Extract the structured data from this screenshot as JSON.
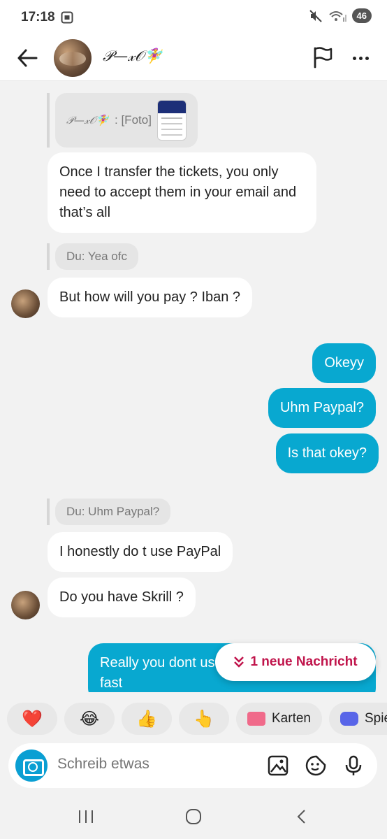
{
  "status": {
    "time": "17:18",
    "battery": "46"
  },
  "header": {
    "contact_name": "𝒫—𝓍𝒪🧚‍♀️"
  },
  "messages": {
    "quote1_name": "𝒫—𝓍𝒪🧚‍♀️",
    "quote1_text": ": [Foto]",
    "m1": "Once I transfer the tickets, you only need to accept them in your email and that’s all",
    "quote2": "Du: Yea ofc",
    "m2": "But how will you pay ? Iban ?",
    "o1": "Okeyy",
    "o2": "Uhm Paypal?",
    "o3": "Is that okey?",
    "quote3": "Du: Uhm Paypal?",
    "m3": "I honestly do t use PayPal",
    "m4": "Do you have Skrill ?",
    "o4": "Really you dont use it? It's more chilly and fast"
  },
  "new_message_pill": "1 neue Nachricht",
  "quick_replies": {
    "heart": "❤️",
    "laugh": "😂",
    "thumbs": "👍",
    "point": "👆",
    "cards": "Karten",
    "games": "Spie"
  },
  "composer": {
    "placeholder": "Schreib etwas"
  },
  "colors": {
    "accent": "#0a9fd3",
    "outgoing_bubble": "#08a8d0",
    "new_message": "#c0144b"
  }
}
